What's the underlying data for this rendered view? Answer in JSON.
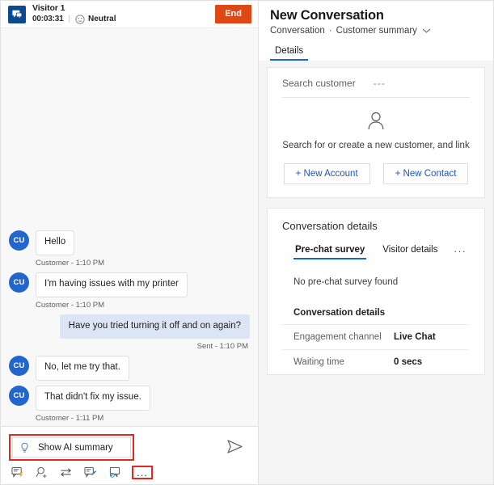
{
  "chat": {
    "header": {
      "visitor_name": "Visitor 1",
      "timer": "00:03:31",
      "sentiment": "Neutral",
      "sentiment_icon": "neutral-face-icon",
      "chat_icon": "chat-bubble-icon",
      "end_label": "End"
    },
    "messages": [
      {
        "sender": "customer",
        "avatar": "CU",
        "text": "Hello",
        "meta": "Customer - 1:10 PM"
      },
      {
        "sender": "customer",
        "avatar": "CU",
        "text": "I'm having issues with my printer",
        "meta": "Customer - 1:10 PM"
      },
      {
        "sender": "agent",
        "text": "Have you tried turning it off and on again?",
        "meta": "Sent - 1:10 PM"
      },
      {
        "sender": "customer",
        "avatar": "CU",
        "text": "No, let me try that.",
        "meta": ""
      },
      {
        "sender": "customer",
        "avatar": "CU",
        "text": "That didn't fix my issue.",
        "meta": "Customer - 1:11 PM"
      }
    ],
    "compose": {
      "ai_summary_label": "Show AI summary",
      "ai_summary_icon": "lightbulb-icon",
      "send_icon": "send-icon",
      "toolbar_icons": [
        "quick-replies-icon",
        "search-knowledge-icon",
        "transfer-icon",
        "notes-icon",
        "consult-icon"
      ],
      "more_label": "..."
    }
  },
  "right_panel": {
    "title": "New Conversation",
    "breadcrumb": {
      "first": "Conversation",
      "separator": "·",
      "second": "Customer summary",
      "chevron_icon": "chevron-down-icon"
    },
    "tabs": [
      {
        "label": "Details",
        "active": true
      }
    ],
    "customer_card": {
      "search_label": "Search customer",
      "search_value": "---",
      "person_icon": "person-icon",
      "empty_text": "Search for or create a new customer, and link",
      "new_account_label": "+ New Account",
      "new_contact_label": "+ New Contact"
    },
    "conversation_card": {
      "title": "Conversation details",
      "sub_tabs": [
        {
          "label": "Pre-chat survey",
          "active": true
        },
        {
          "label": "Visitor details",
          "active": false
        }
      ],
      "sub_tabs_more": "...",
      "no_survey_text": "No pre-chat survey found",
      "section_title": "Conversation details",
      "fields": [
        {
          "key": "Engagement channel",
          "value": "Live Chat"
        },
        {
          "key": "Waiting time",
          "value": "0 secs"
        }
      ]
    }
  },
  "colors": {
    "accent": "#1366d6",
    "end_button": "#dd4814",
    "highlight": "#e8251f",
    "avatar": "#2266cc",
    "agent_bubble": "#dce5f5"
  }
}
